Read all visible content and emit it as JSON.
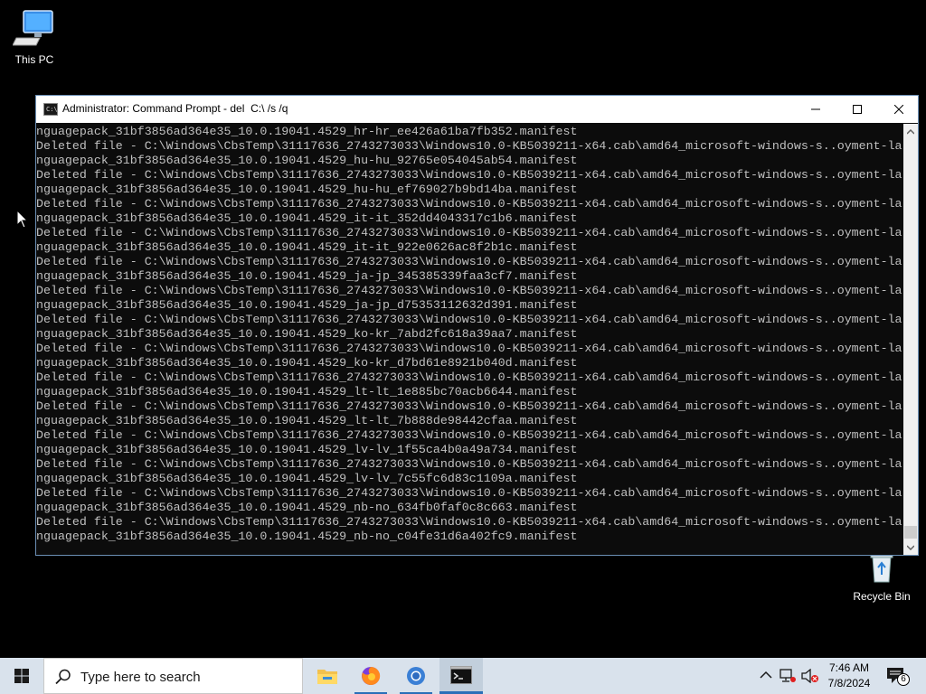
{
  "desktop": {
    "icons": [
      {
        "label": "This PC",
        "icon": "computer-icon"
      },
      {
        "label": "Recycle Bin",
        "icon": "recycle-bin-icon"
      }
    ]
  },
  "window": {
    "title": "Administrator: Command Prompt - del  C:\\ /s /q",
    "icon": "cmd-icon",
    "controls": [
      "minimize",
      "maximize",
      "close"
    ]
  },
  "console": {
    "lines": [
      "nguagepack_31bf3856ad364e35_10.0.19041.4529_hr-hr_ee426a61ba7fb352.manifest",
      "Deleted file - C:\\Windows\\CbsTemp\\31117636_2743273033\\Windows10.0-KB5039211-x64.cab\\amd64_microsoft-windows-s..oyment-la",
      "nguagepack_31bf3856ad364e35_10.0.19041.4529_hu-hu_92765e054045ab54.manifest",
      "Deleted file - C:\\Windows\\CbsTemp\\31117636_2743273033\\Windows10.0-KB5039211-x64.cab\\amd64_microsoft-windows-s..oyment-la",
      "nguagepack_31bf3856ad364e35_10.0.19041.4529_hu-hu_ef769027b9bd14ba.manifest",
      "Deleted file - C:\\Windows\\CbsTemp\\31117636_2743273033\\Windows10.0-KB5039211-x64.cab\\amd64_microsoft-windows-s..oyment-la",
      "nguagepack_31bf3856ad364e35_10.0.19041.4529_it-it_352dd4043317c1b6.manifest",
      "Deleted file - C:\\Windows\\CbsTemp\\31117636_2743273033\\Windows10.0-KB5039211-x64.cab\\amd64_microsoft-windows-s..oyment-la",
      "nguagepack_31bf3856ad364e35_10.0.19041.4529_it-it_922e0626ac8f2b1c.manifest",
      "Deleted file - C:\\Windows\\CbsTemp\\31117636_2743273033\\Windows10.0-KB5039211-x64.cab\\amd64_microsoft-windows-s..oyment-la",
      "nguagepack_31bf3856ad364e35_10.0.19041.4529_ja-jp_345385339faa3cf7.manifest",
      "Deleted file - C:\\Windows\\CbsTemp\\31117636_2743273033\\Windows10.0-KB5039211-x64.cab\\amd64_microsoft-windows-s..oyment-la",
      "nguagepack_31bf3856ad364e35_10.0.19041.4529_ja-jp_d75353112632d391.manifest",
      "Deleted file - C:\\Windows\\CbsTemp\\31117636_2743273033\\Windows10.0-KB5039211-x64.cab\\amd64_microsoft-windows-s..oyment-la",
      "nguagepack_31bf3856ad364e35_10.0.19041.4529_ko-kr_7abd2fc618a39aa7.manifest",
      "Deleted file - C:\\Windows\\CbsTemp\\31117636_2743273033\\Windows10.0-KB5039211-x64.cab\\amd64_microsoft-windows-s..oyment-la",
      "nguagepack_31bf3856ad364e35_10.0.19041.4529_ko-kr_d7bd61e8921b040d.manifest",
      "Deleted file - C:\\Windows\\CbsTemp\\31117636_2743273033\\Windows10.0-KB5039211-x64.cab\\amd64_microsoft-windows-s..oyment-la",
      "nguagepack_31bf3856ad364e35_10.0.19041.4529_lt-lt_1e885bc70acb6644.manifest",
      "Deleted file - C:\\Windows\\CbsTemp\\31117636_2743273033\\Windows10.0-KB5039211-x64.cab\\amd64_microsoft-windows-s..oyment-la",
      "nguagepack_31bf3856ad364e35_10.0.19041.4529_lt-lt_7b888de98442cfaa.manifest",
      "Deleted file - C:\\Windows\\CbsTemp\\31117636_2743273033\\Windows10.0-KB5039211-x64.cab\\amd64_microsoft-windows-s..oyment-la",
      "nguagepack_31bf3856ad364e35_10.0.19041.4529_lv-lv_1f55ca4b0a49a734.manifest",
      "Deleted file - C:\\Windows\\CbsTemp\\31117636_2743273033\\Windows10.0-KB5039211-x64.cab\\amd64_microsoft-windows-s..oyment-la",
      "nguagepack_31bf3856ad364e35_10.0.19041.4529_lv-lv_7c55fc6d83c1109a.manifest",
      "Deleted file - C:\\Windows\\CbsTemp\\31117636_2743273033\\Windows10.0-KB5039211-x64.cab\\amd64_microsoft-windows-s..oyment-la",
      "nguagepack_31bf3856ad364e35_10.0.19041.4529_nb-no_634fb0faf0c8c663.manifest",
      "Deleted file - C:\\Windows\\CbsTemp\\31117636_2743273033\\Windows10.0-KB5039211-x64.cab\\amd64_microsoft-windows-s..oyment-la",
      "nguagepack_31bf3856ad364e35_10.0.19041.4529_nb-no_c04fe31d6a402fc9.manifest"
    ]
  },
  "taskbar": {
    "search_placeholder": "Type here to search",
    "apps": [
      "file-explorer-icon",
      "firefox-icon",
      "chrome-icon",
      "cmd-icon"
    ],
    "tray_icons": [
      "chevron-up-icon",
      "network-icon",
      "speaker-muted-icon"
    ],
    "time": "7:46 AM",
    "date": "7/8/2024",
    "notification_count": "6"
  },
  "colors": {
    "console_bg": "#0c0c0c",
    "console_text": "#c0c0c0",
    "taskbar_bg": "#d9e2ec",
    "accent": "#2a6fb8"
  }
}
